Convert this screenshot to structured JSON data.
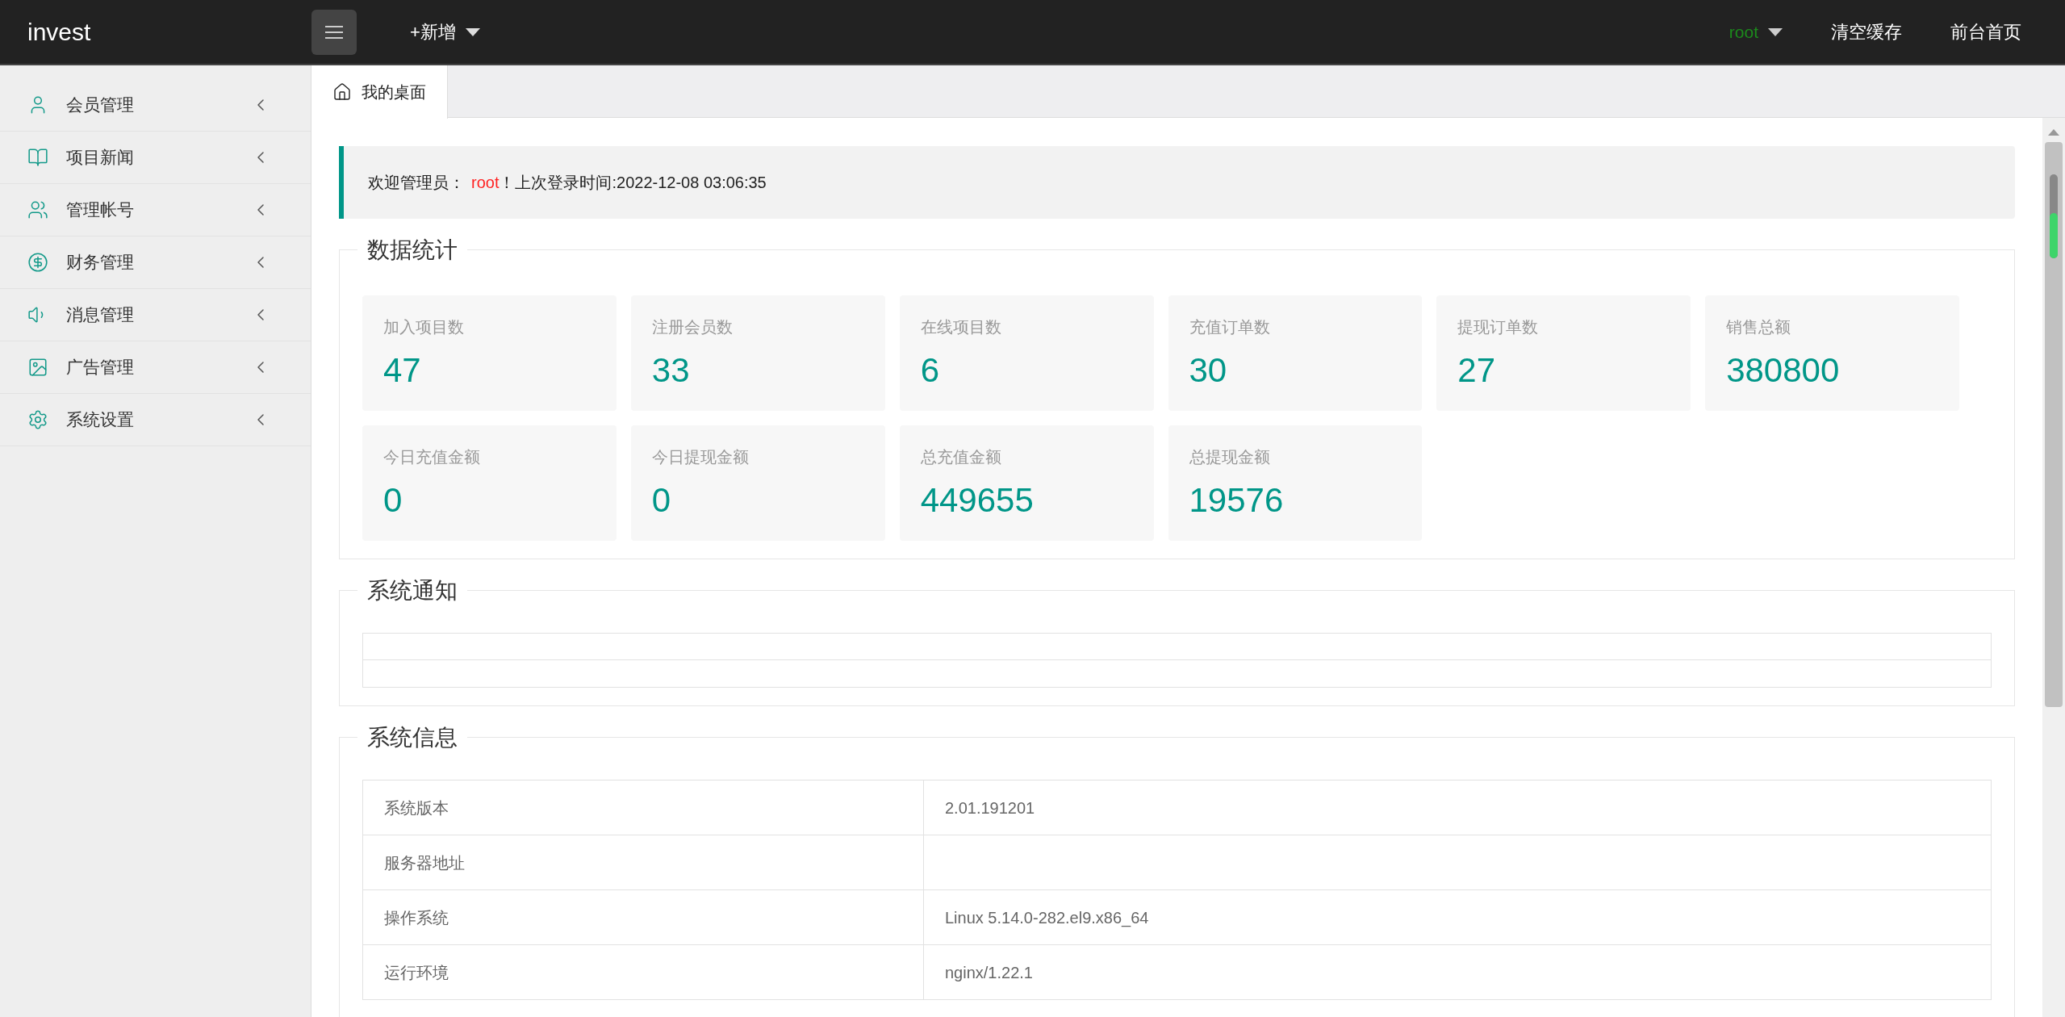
{
  "header": {
    "logo": "invest",
    "add_menu": "+新增",
    "user": "root",
    "actions": [
      "清空缓存",
      "前台首页"
    ]
  },
  "sidebar": {
    "items": [
      {
        "label": "会员管理"
      },
      {
        "label": "项目新闻"
      },
      {
        "label": "管理帐号"
      },
      {
        "label": "财务管理"
      },
      {
        "label": "消息管理"
      },
      {
        "label": "广告管理"
      },
      {
        "label": "系统设置"
      }
    ]
  },
  "tabs": [
    {
      "label": "我的桌面",
      "selected": true
    }
  ],
  "welcome": {
    "prefix": "欢迎管理员：",
    "user": "root",
    "suffix": "！上次登录时间:2022-12-08 03:06:35"
  },
  "stats": {
    "title": "数据统计",
    "cards": [
      {
        "label": "加入项目数",
        "value": "47"
      },
      {
        "label": "注册会员数",
        "value": "33"
      },
      {
        "label": "在线项目数",
        "value": "6"
      },
      {
        "label": "充值订单数",
        "value": "30"
      },
      {
        "label": "提现订单数",
        "value": "27"
      },
      {
        "label": "销售总额",
        "value": "380800"
      },
      {
        "label": "今日充值金额",
        "value": "0"
      },
      {
        "label": "今日提现金额",
        "value": "0"
      },
      {
        "label": "总充值金额",
        "value": "449655"
      },
      {
        "label": "总提现金额",
        "value": "19576"
      }
    ]
  },
  "notice": {
    "title": "系统通知"
  },
  "system_info": {
    "title": "系统信息",
    "rows": [
      {
        "label": "系统版本",
        "value": "2.01.191201"
      },
      {
        "label": "服务器地址",
        "value": ""
      },
      {
        "label": "操作系统",
        "value": "Linux 5.14.0-282.el9.x86_64"
      },
      {
        "label": "运行环境",
        "value": "nginx/1.22.1"
      }
    ]
  }
}
